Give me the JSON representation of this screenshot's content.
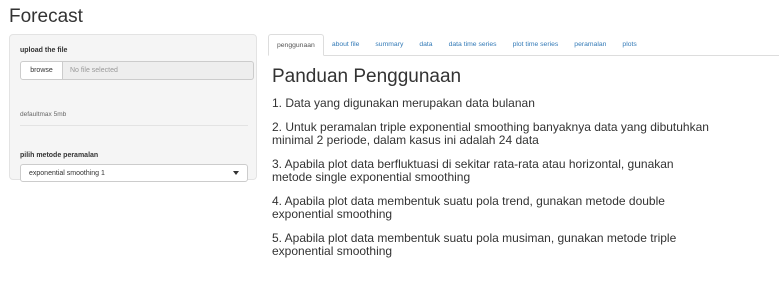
{
  "app": {
    "title": "Forecast"
  },
  "sidebar": {
    "upload_label": "upload the file",
    "browse_label": "browse",
    "file_placeholder": "No file selected",
    "max_note": "defaultmax 5mb",
    "method_label": "pilih metode peramalan",
    "method_selected": "exponential smoothing 1"
  },
  "tabs": [
    {
      "label": "penggunaan",
      "active": true
    },
    {
      "label": "about file"
    },
    {
      "label": "summary"
    },
    {
      "label": "data"
    },
    {
      "label": "data time series"
    },
    {
      "label": "plot time series"
    },
    {
      "label": "peramalan"
    },
    {
      "label": "plots"
    }
  ],
  "main": {
    "heading": "Panduan Penggunaan",
    "items": [
      [
        "1. Data yang digunakan merupakan data bulanan"
      ],
      [
        "2. Untuk peramalan triple exponential smoothing banyaknya data yang dibutuhkan",
        "minimal 2 periode, dalam kasus ini adalah 24 data"
      ],
      [
        "3. Apabila plot data berfluktuasi di sekitar rata-rata atau horizontal, gunakan",
        "metode single exponential smoothing"
      ],
      [
        "4. Apabila plot data membentuk suatu pola trend, gunakan metode double",
        "exponential smoothing"
      ],
      [
        "5. Apabila plot data membentuk suatu pola musiman, gunakan metode triple",
        "exponential smoothing"
      ]
    ]
  }
}
